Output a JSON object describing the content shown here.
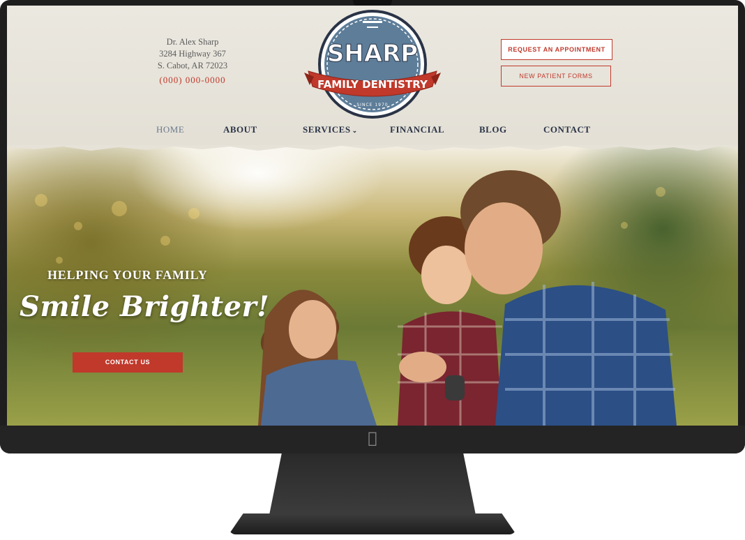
{
  "practice": {
    "doctor": "Dr. Alex Sharp",
    "street": "3284 Highway 367",
    "city": "S. Cabot, AR 72023",
    "phone": "(000) 000-0000"
  },
  "logo": {
    "word": "SHARP",
    "banner": "FAMILY DENTISTRY",
    "since": "SINCE 1970"
  },
  "header_buttons": {
    "appointment": "REQUEST AN APPOINTMENT",
    "forms": "NEW PATIENT FORMS"
  },
  "nav": [
    {
      "label": "HOME"
    },
    {
      "label": "ABOUT"
    },
    {
      "label": "SERVICES",
      "icon": "chevron-down-icon"
    },
    {
      "label": "FINANCIAL"
    },
    {
      "label": "BLOG"
    },
    {
      "label": "CONTACT"
    }
  ],
  "hero": {
    "kicker": "HELPING YOUR FAMILY",
    "title": "Smile Brighter!",
    "cta": "CONTACT US"
  },
  "colors": {
    "accent": "#c0392b",
    "navy": "#2a3346",
    "logo_blue": "#5d7d99",
    "paper": "#e8e4da"
  }
}
